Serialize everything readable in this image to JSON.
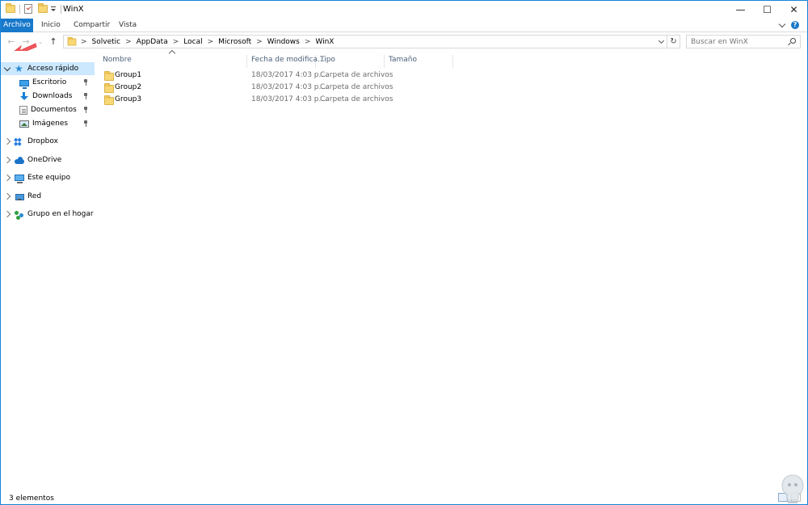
{
  "window": {
    "title": "WinX",
    "controls": {
      "minimize": "—",
      "maximize": "☐",
      "close": "✕"
    }
  },
  "ribbon": {
    "tabs": [
      "Archivo",
      "Inicio",
      "Compartir",
      "Vista"
    ]
  },
  "nav": {
    "breadcrumb": [
      "Solvetic",
      "AppData",
      "Local",
      "Microsoft",
      "Windows",
      "WinX"
    ],
    "breadcrumb_sep": ">",
    "search_placeholder": "Buscar en WinX",
    "back_glyph": "←",
    "forward_glyph": "→",
    "recent_glyph": "⌄",
    "up_glyph": "↑",
    "refresh_glyph": "↻"
  },
  "sidebar": {
    "items": [
      {
        "label": "Acceso rápido",
        "icon": "star-icon",
        "expanded": true,
        "selected": true
      },
      {
        "label": "Escritorio",
        "icon": "desktop-icon",
        "pinned": true
      },
      {
        "label": "Downloads",
        "icon": "download-icon",
        "pinned": true
      },
      {
        "label": "Documentos",
        "icon": "docs-icon",
        "pinned": true
      },
      {
        "label": "Imágenes",
        "icon": "images-icon",
        "pinned": true
      },
      {
        "label": "Dropbox",
        "icon": "dropbox-icon"
      },
      {
        "label": "OneDrive",
        "icon": "cloud-icon"
      },
      {
        "label": "Este equipo",
        "icon": "pc-icon"
      },
      {
        "label": "Red",
        "icon": "network-icon"
      },
      {
        "label": "Grupo en el hogar",
        "icon": "homegroup-icon"
      }
    ]
  },
  "content": {
    "columns": [
      "Nombre",
      "Fecha de modifica...",
      "Tipo",
      "Tamaño"
    ],
    "rows": [
      {
        "name": "Group1",
        "date": "18/03/2017 4:03 p....",
        "type": "Carpeta de archivos",
        "size": ""
      },
      {
        "name": "Group2",
        "date": "18/03/2017 4:03 p....",
        "type": "Carpeta de archivos",
        "size": ""
      },
      {
        "name": "Group3",
        "date": "18/03/2017 4:03 p....",
        "type": "Carpeta de archivos",
        "size": ""
      }
    ]
  },
  "status": {
    "item_count": "3 elementos"
  },
  "colors": {
    "accent": "#1979ca",
    "selection": "#cce8ff",
    "folder": "#f8d775",
    "annotation_arrow": "#f0565c"
  }
}
